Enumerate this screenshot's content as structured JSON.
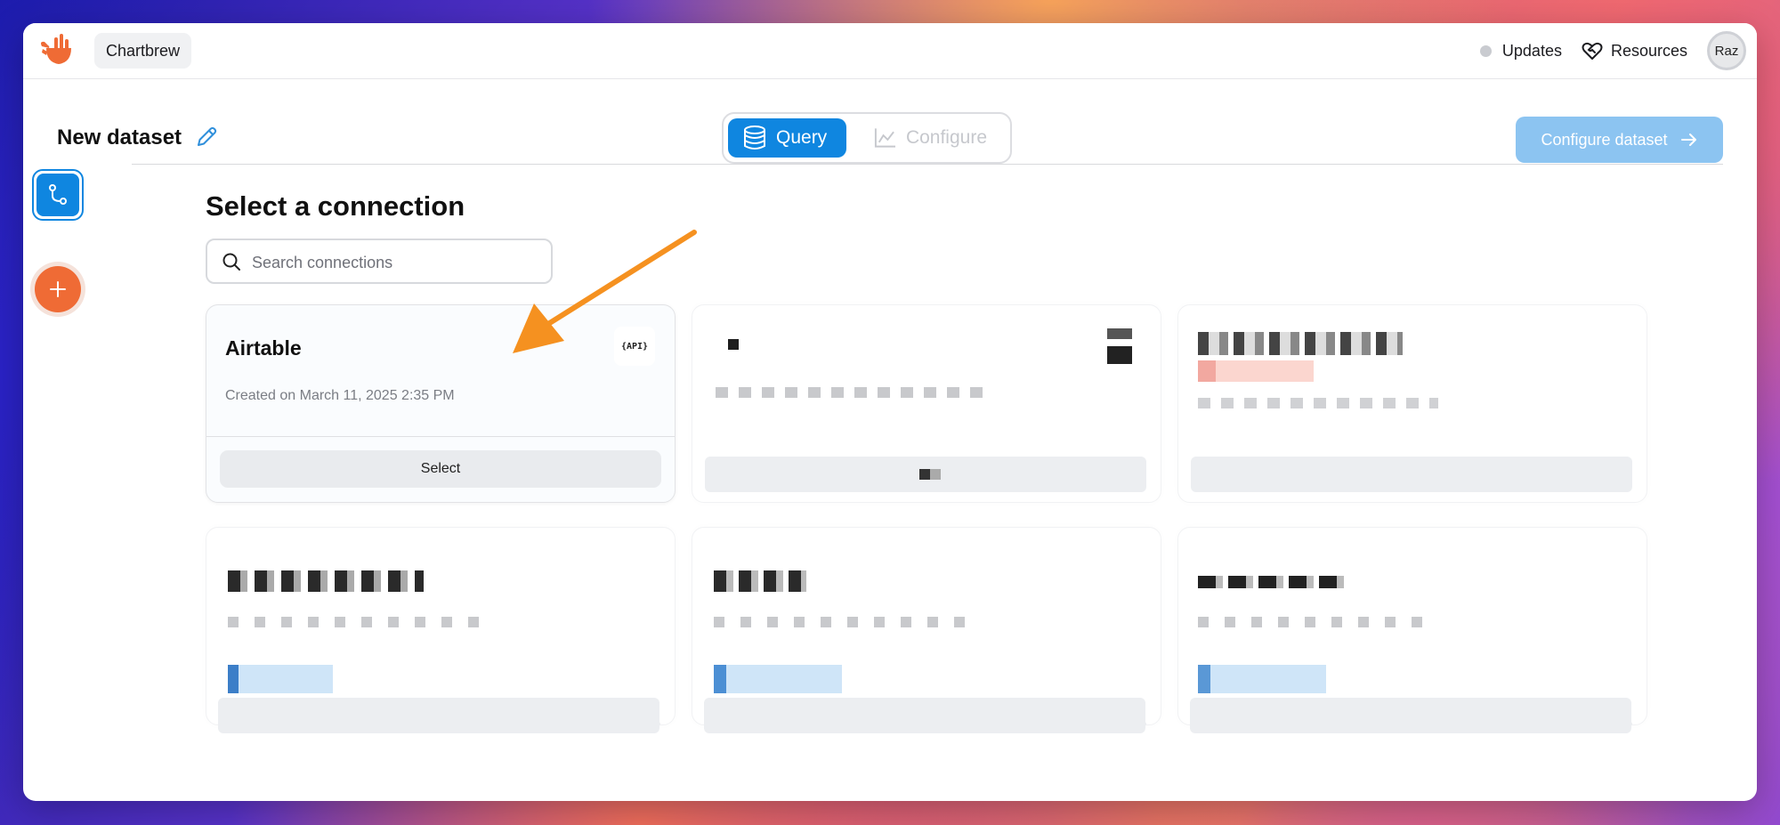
{
  "app": {
    "brand": "Chartbrew"
  },
  "topbar": {
    "updates_label": "Updates",
    "resources_label": "Resources",
    "avatar_initials": "Raz"
  },
  "header": {
    "dataset_title": "New dataset",
    "tabs": [
      {
        "label": "Query",
        "active": true
      },
      {
        "label": "Configure",
        "active": false
      }
    ],
    "configure_button_label": "Configure dataset"
  },
  "main": {
    "section_title": "Select a connection",
    "search": {
      "placeholder": "Search connections",
      "value": ""
    },
    "connections": [
      {
        "name": "Airtable",
        "badge": "{API}",
        "created": "Created on March 11, 2025 2:35 PM",
        "select_label": "Select"
      }
    ]
  },
  "colors": {
    "accent": "#0f86e0",
    "orange": "#ef6b35",
    "arrow": "#f59120"
  },
  "icons": {
    "logo": "chartbrew-logo",
    "edit": "pencil-icon",
    "query": "database-icon",
    "configure": "chart-line-icon",
    "arrow_right": "arrow-right-icon",
    "connection": "git-branch-icon",
    "add": "plus-icon",
    "search": "search-icon",
    "resources": "heart-handshake-icon"
  }
}
